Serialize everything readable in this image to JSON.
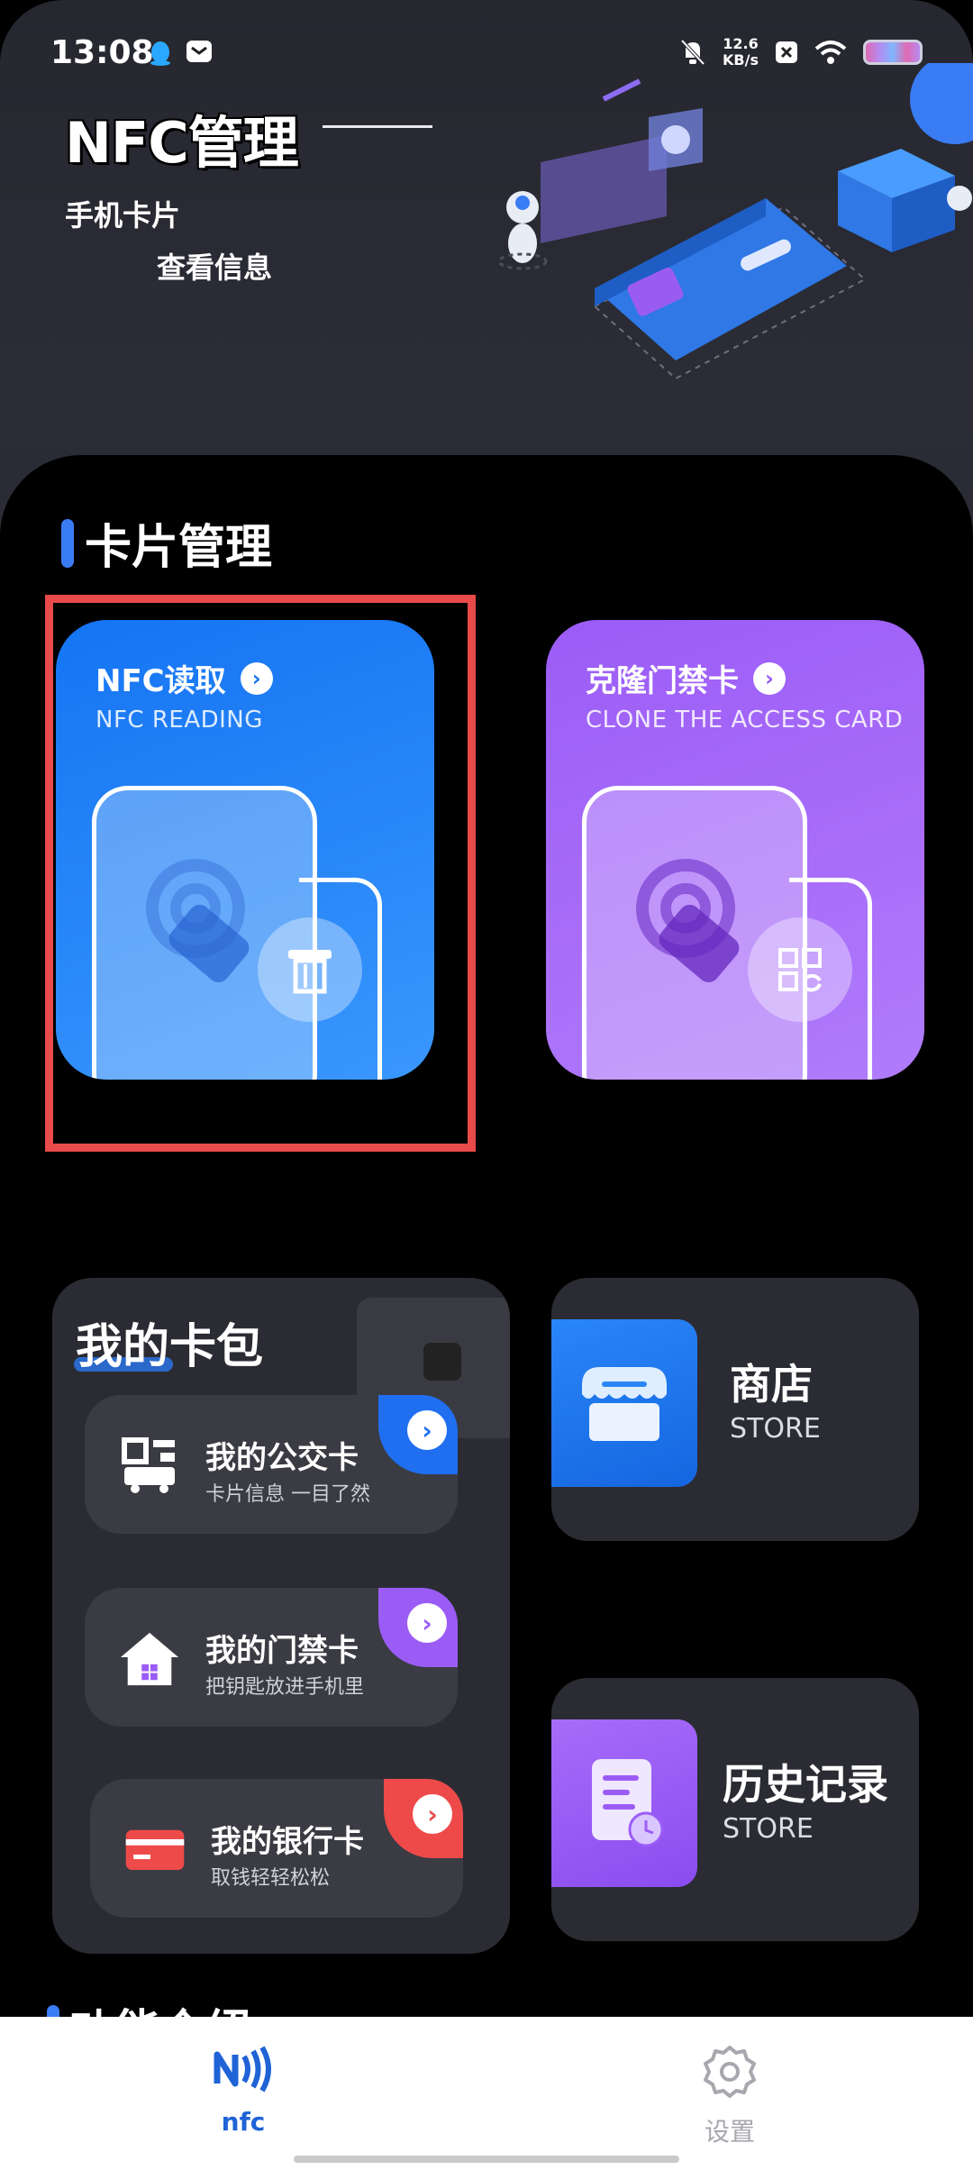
{
  "status_bar": {
    "time": "13:08",
    "speed_value": "12.6",
    "speed_unit": "KB/s"
  },
  "header": {
    "title": "NFC管理",
    "subtitle_line1": "手机卡片",
    "subtitle_line2": "查看信息"
  },
  "card_section": {
    "title": "卡片管理",
    "cards": [
      {
        "title": "NFC读取",
        "subtitle": "NFC READING",
        "icon": "card-reader-icon"
      },
      {
        "title": "克隆门禁卡",
        "subtitle": "CLONE THE ACCESS CARD",
        "icon": "clone-icon"
      }
    ]
  },
  "wallet": {
    "title": "我的卡包",
    "items": [
      {
        "title": "我的公交卡",
        "subtitle": "卡片信息 一目了然",
        "accent": "#1f6ff0",
        "icon": "bus-icon"
      },
      {
        "title": "我的门禁卡",
        "subtitle": "把钥匙放进手机里",
        "accent": "#9b5cf6",
        "icon": "house-icon"
      },
      {
        "title": "我的银行卡",
        "subtitle": "取钱轻轻松松",
        "accent": "#ee4a4a",
        "icon": "bank-card-icon"
      }
    ]
  },
  "tiles": {
    "store": {
      "title": "商店",
      "subtitle": "STORE",
      "icon": "store-icon"
    },
    "history": {
      "title": "历史记录",
      "subtitle": "STORE",
      "icon": "history-icon"
    }
  },
  "section2": {
    "title": "功能介绍"
  },
  "bottom_nav": {
    "nfc_label": "nfc",
    "settings_label": "设置"
  },
  "colors": {
    "accent_blue": "#1f6ff0",
    "accent_purple": "#9b5cf6",
    "accent_red": "#ee4a4a",
    "highlight_red": "#e94a4a"
  }
}
